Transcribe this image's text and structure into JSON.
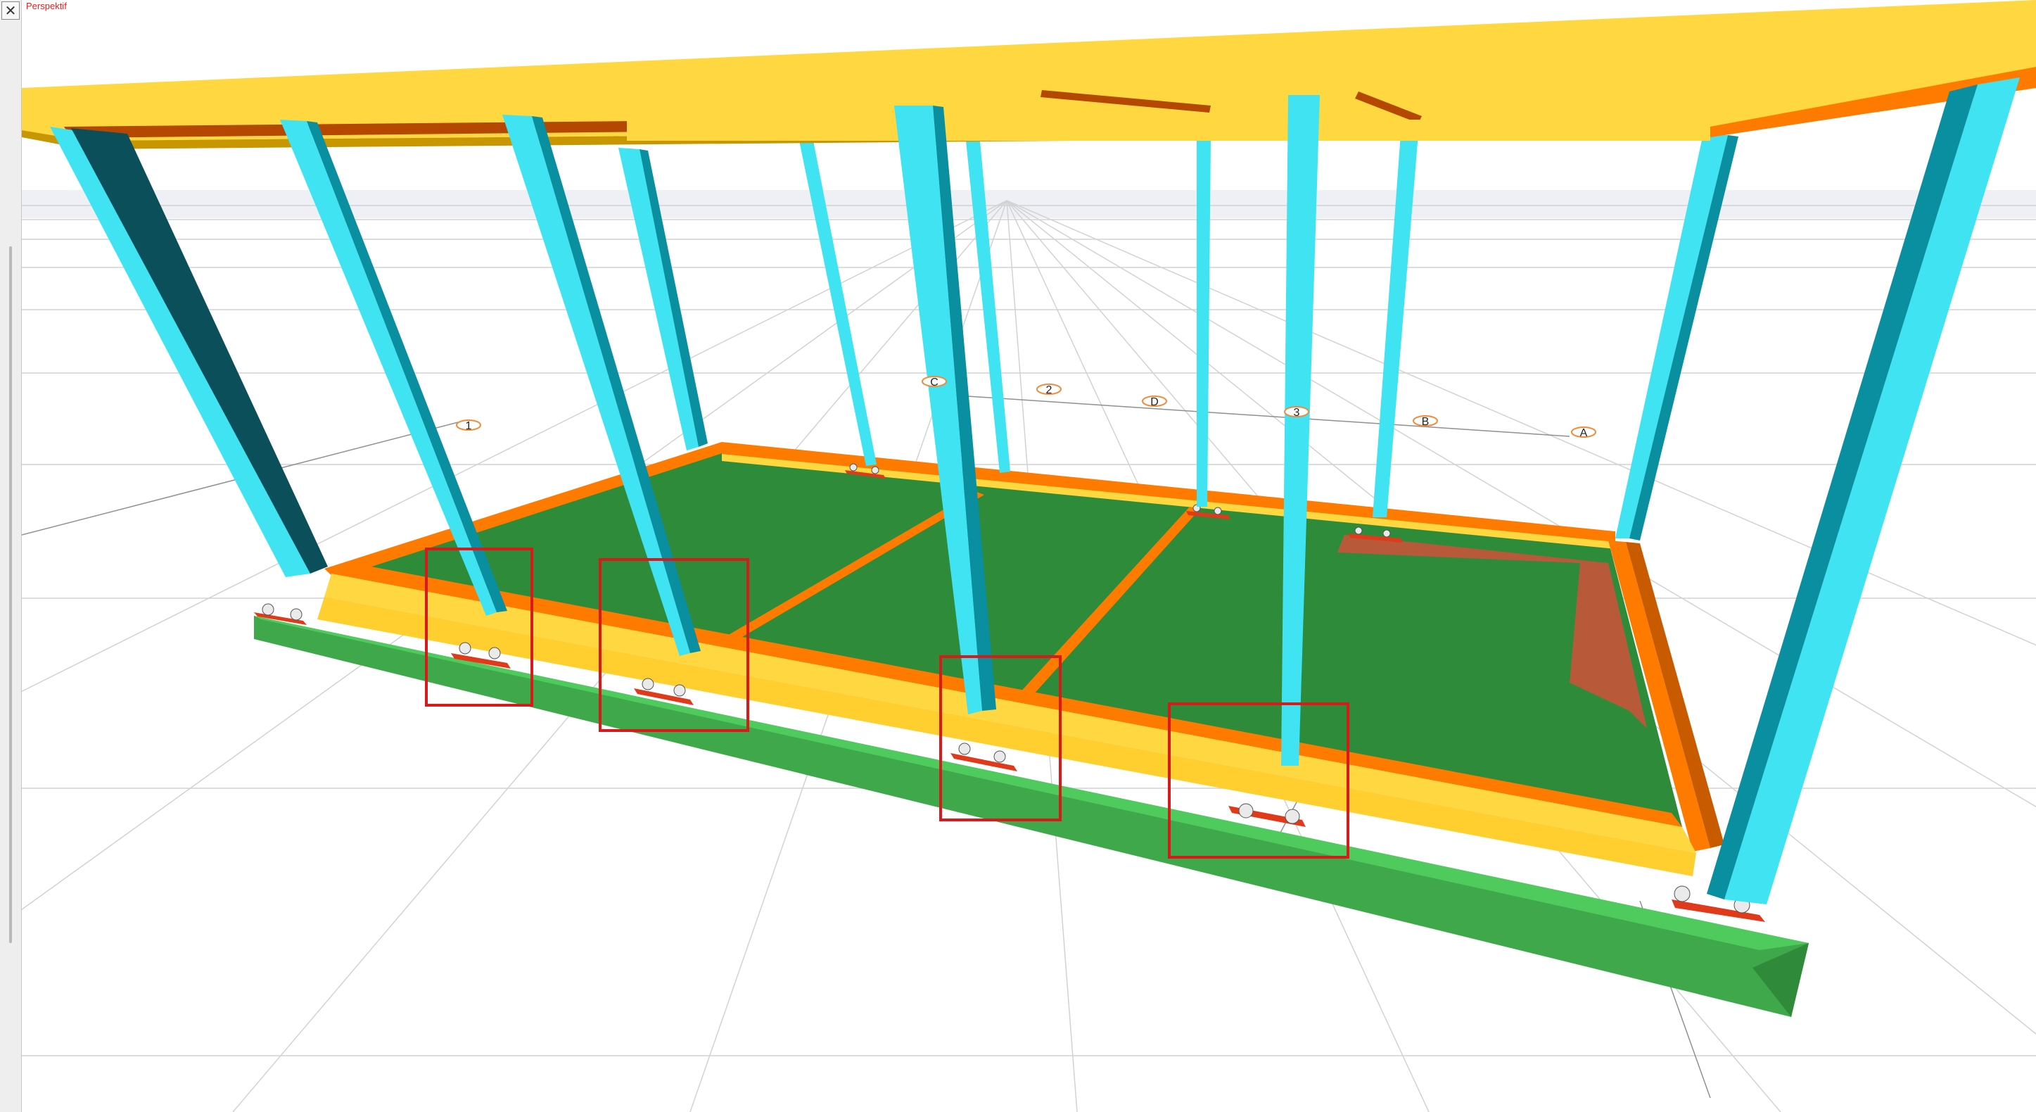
{
  "window": {
    "close_glyph": "✕"
  },
  "viewport": {
    "label": "Perspektif",
    "label_color": "#e02020"
  },
  "grid_labels": [
    "1",
    "C",
    "2",
    "D",
    "3",
    "B",
    "A"
  ],
  "colors": {
    "slab": "#4ecb5c",
    "slab_side": "#44b84f",
    "floor": "#2e8b3a",
    "beam_yellow": "#ffd740",
    "beam_orange": "#ff7b00",
    "beam_brown": "#b44800",
    "column": "#3fe3f2",
    "column_shade": "#067f8e",
    "baseplate": "#e03a1a",
    "bolt": "#eaeaea",
    "highlight_box": "#d81a1a"
  },
  "icons": {
    "close": "close-icon"
  }
}
